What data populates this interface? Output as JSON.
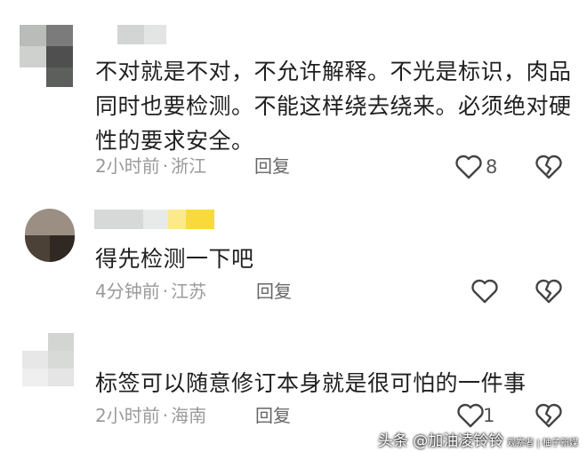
{
  "comments": [
    {
      "text": "不对就是不对，不允许解释。不光是标识，肉品同时也要检测。不能这样绕去绕来。必须绝对硬性的要求安全。",
      "time": "2小时前",
      "location": "浙江",
      "reply": "回复",
      "likes": "8",
      "like_icon": "heart-outline-icon",
      "dislike_icon": "broken-heart-icon"
    },
    {
      "text": "得先检测一下吧",
      "time": "4分钟前",
      "location": "江苏",
      "reply": "回复",
      "likes": "",
      "like_icon": "heart-outline-icon",
      "dislike_icon": "broken-heart-icon"
    },
    {
      "text": "标签可以随意修订本身就是很可怕的一件事",
      "time": "2小时前",
      "location": "海南",
      "reply": "回复",
      "likes": "1",
      "like_icon": "heart-outline-icon",
      "dislike_icon": "broken-heart-icon"
    }
  ],
  "separator": "·",
  "watermark": {
    "main": "头条 @加油凌铃铃",
    "sub": "观察者 | 柚子新媒"
  },
  "colors": {
    "text": "#1f1f1f",
    "meta": "#9a9a9a",
    "icon": "#444444"
  }
}
